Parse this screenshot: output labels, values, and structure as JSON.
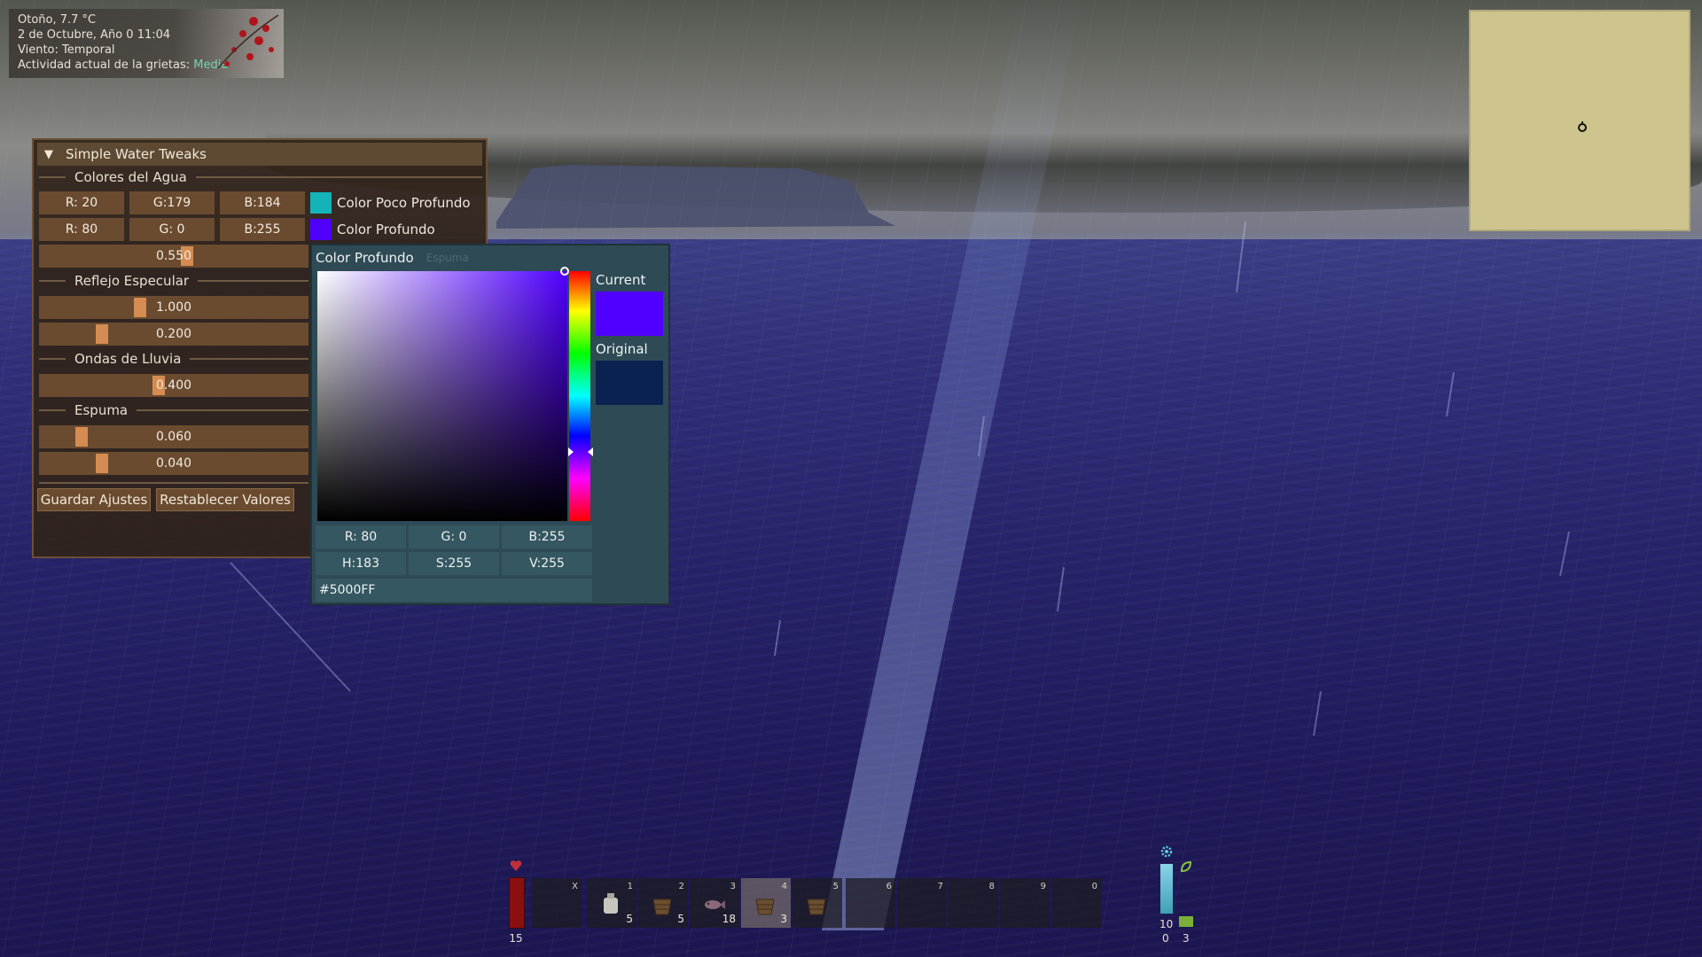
{
  "weather": {
    "line1": "Otoño, 7.7 °C",
    "line2": "2 de Octubre, Año 0 11:04",
    "line3": "Viento: Temporal",
    "line4_prefix": "Actividad actual de la grietas: ",
    "line4_value": "Media"
  },
  "panel": {
    "title": "Simple Water Tweaks",
    "sections": {
      "water_colors": "Colores del Agua",
      "specular": "Reflejo Especular",
      "rain_waves": "Ondas de Lluvia",
      "foam": "Espuma"
    },
    "shallow": {
      "r": "R: 20",
      "g": "G:179",
      "b": "B:184",
      "label": "Color Poco Profundo",
      "color": "#14b3b8"
    },
    "deep": {
      "r": "R: 80",
      "g": "G:  0",
      "b": "B:255",
      "label": "Color Profundo",
      "color": "#5000ff"
    },
    "sliders": {
      "depth": {
        "value": "0.550",
        "fraction": 0.55
      },
      "specular1": {
        "value": "1.000",
        "fraction": 0.37
      },
      "specular2": {
        "value": "0.200",
        "fraction": 0.22
      },
      "rain": {
        "value": "0.400",
        "fraction": 0.44
      },
      "foam1": {
        "value": "0.060",
        "fraction": 0.14
      },
      "foam2": {
        "value": "0.040",
        "fraction": 0.22
      }
    },
    "save_label": "Guardar Ajustes",
    "reset_label": "Restablecer Valores"
  },
  "picker": {
    "title": "Color Profundo",
    "ghost": "Espuma",
    "current_label": "Current",
    "original_label": "Original",
    "current_color": "#5000ff",
    "original_color": "#0a2250",
    "r": "R: 80",
    "g": "G:  0",
    "b": "B:255",
    "h": "H:183",
    "s": "S:255",
    "v": "V:255",
    "hex": "#5000FF"
  },
  "hud": {
    "health": "15",
    "temp_value": "10",
    "temp_sub": "0",
    "sat_value": "3",
    "hotbar": [
      {
        "key": "X",
        "count": ""
      },
      {
        "key": "1",
        "count": "5",
        "item": "jug"
      },
      {
        "key": "2",
        "count": "5",
        "item": "basket"
      },
      {
        "key": "3",
        "count": "18",
        "item": "fish"
      },
      {
        "key": "4",
        "count": "3",
        "item": "basket",
        "selected": true
      },
      {
        "key": "5",
        "count": "",
        "item": "basket"
      },
      {
        "key": "6",
        "count": ""
      },
      {
        "key": "7",
        "count": ""
      },
      {
        "key": "8",
        "count": ""
      },
      {
        "key": "9",
        "count": ""
      },
      {
        "key": "0",
        "count": ""
      }
    ]
  },
  "colors": {
    "minimap": "#cec48e",
    "panel_bg": "#30241a",
    "cell": "#6a4b2f",
    "knob": "#d48c52",
    "picker_bg": "#2e4a55",
    "accent_text": "#6fd6b0"
  }
}
